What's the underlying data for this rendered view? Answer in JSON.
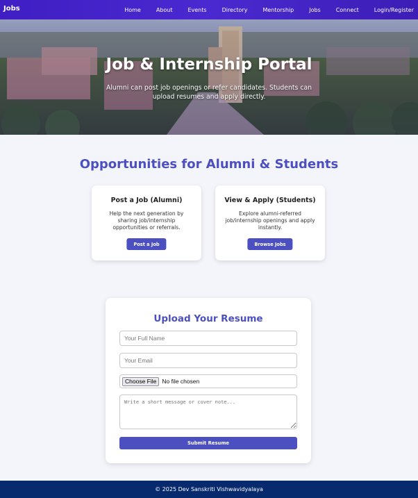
{
  "nav": {
    "brand": "Jobs",
    "links": [
      "Home",
      "About",
      "Events",
      "Directory",
      "Mentorship",
      "Jobs",
      "Connect",
      "Login/Register"
    ]
  },
  "hero": {
    "title": "Job & Internship Portal",
    "subtitle": "Alumni can post job openings or refer candidates. Students can upload resumes and apply directly."
  },
  "opportunities": {
    "title": "Opportunities for Alumni & Students",
    "cards": [
      {
        "title": "Post a Job (Alumni)",
        "description": "Help the next generation by sharing job/internship opportunities or referrals.",
        "button": "Post a Job"
      },
      {
        "title": "View & Apply (Students)",
        "description": "Explore alumni-referred job/internship openings and apply instantly.",
        "button": "Browse Jobs"
      }
    ]
  },
  "upload": {
    "title": "Upload Your Resume",
    "name_placeholder": "Your Full Name",
    "email_placeholder": "Your Email",
    "file_button": "Choose File",
    "file_status": "No file chosen",
    "message_placeholder": "Write a short message or cover note...",
    "submit": "Submit Resume"
  },
  "footer": {
    "text": "© 2025 Dev Sanskriti Vishwavidyalaya"
  },
  "colors": {
    "nav": "#3f1fc4",
    "accent": "#4b4fc0",
    "footer": "#062a6d",
    "page_bg": "#f4f5fb"
  }
}
